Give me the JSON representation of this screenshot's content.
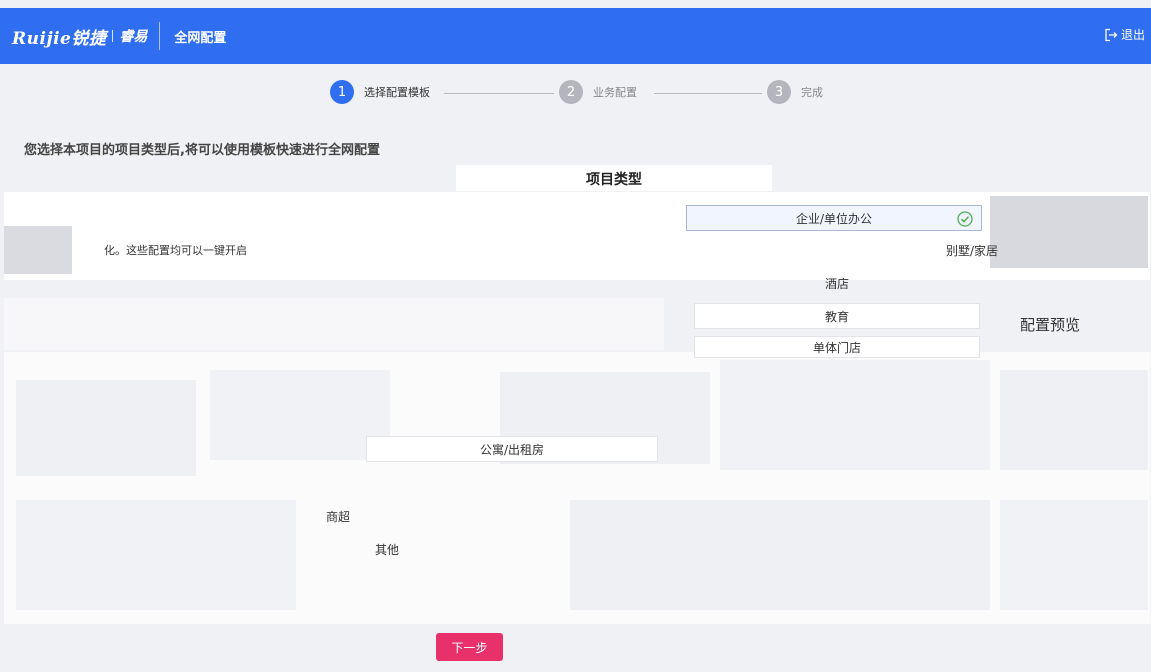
{
  "header": {
    "brand": "Ruijie锐捷",
    "product": "睿易",
    "app_title": "全网配置",
    "logout_label": "退出",
    "background_color": "#2f6ef0"
  },
  "steps": [
    {
      "number": "1",
      "label": "选择配置模板",
      "active": true
    },
    {
      "number": "2",
      "label": "业务配置",
      "active": false
    },
    {
      "number": "3",
      "label": "完成",
      "active": false
    }
  ],
  "intro_text": "您选择本项目的项目类型后,将可以使用模板快速进行全网配置",
  "project_types": {
    "title": "项目类型",
    "options": [
      {
        "label": "企业/单位办公",
        "selected": true
      },
      {
        "label": "别墅/家居",
        "selected": false
      },
      {
        "label": "酒店",
        "selected": false
      },
      {
        "label": "教育",
        "selected": false
      },
      {
        "label": "单体门店",
        "selected": false
      },
      {
        "label": "公寓/出租房",
        "selected": false
      },
      {
        "label": "商超",
        "selected": false
      },
      {
        "label": "其他",
        "selected": false
      }
    ]
  },
  "template_desc_tail": "化。这些配置均可以一键开启",
  "preview_title": "配置预览",
  "next_button": "下一步",
  "colors": {
    "primary": "#2f6ef0",
    "step_active": "#2f6ef0",
    "step_inactive": "#b3b6bd",
    "next_button": "#e8306a",
    "check": "#4caf50"
  }
}
